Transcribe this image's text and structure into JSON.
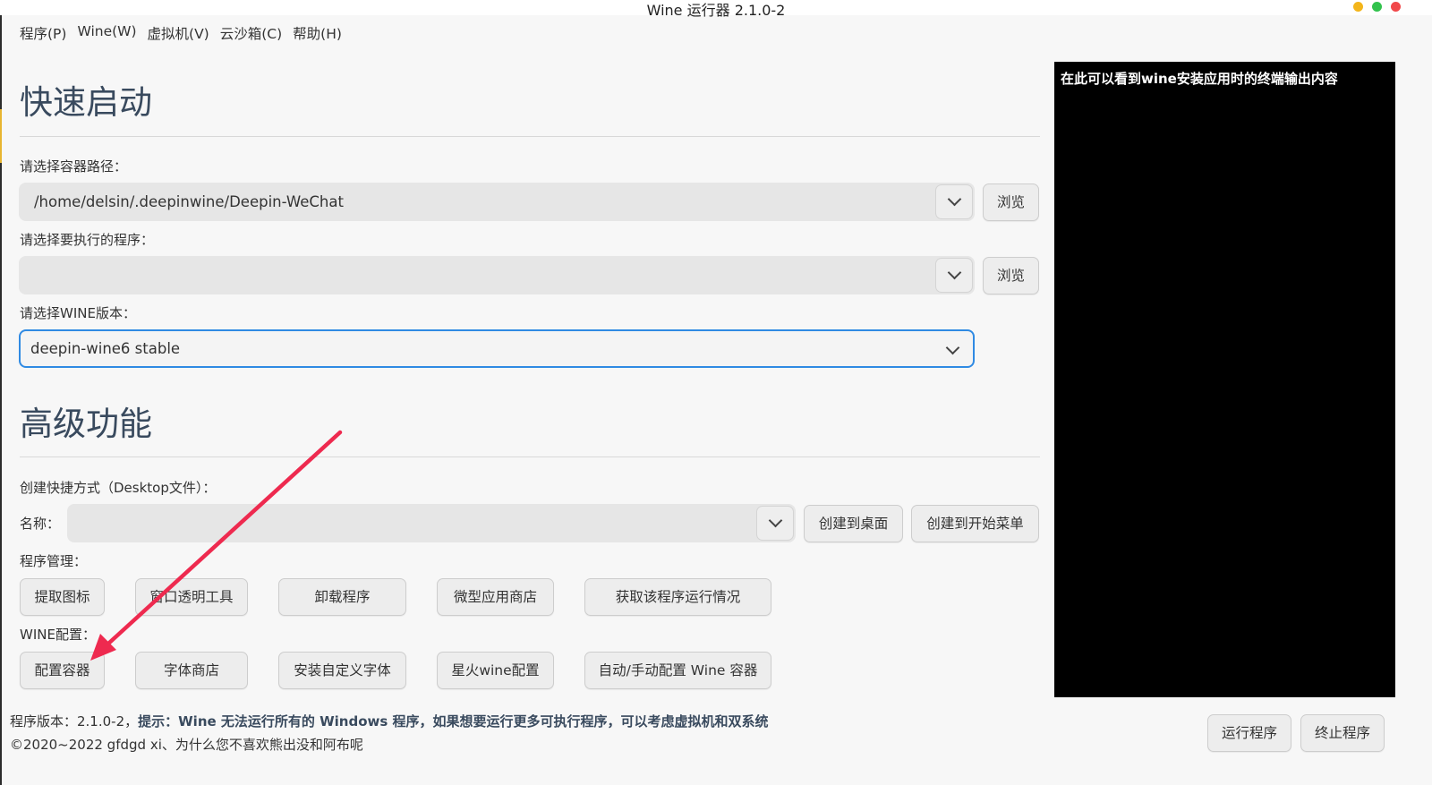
{
  "window": {
    "title": "Wine 运行器 2.1.0-2"
  },
  "menu": [
    "程序(P)",
    "Wine(W)",
    "虚拟机(V)",
    "云沙箱(C)",
    "帮助(H)"
  ],
  "quick_start": {
    "title": "快速启动",
    "container_label": "请选择容器路径：",
    "container_value": "/home/delsin/.deepinwine/Deepin-WeChat",
    "browse": "浏览",
    "program_label": "请选择要执行的程序：",
    "program_value": "",
    "wine_label": "请选择WINE版本：",
    "wine_value": "deepin-wine6 stable"
  },
  "advanced": {
    "title": "高级功能",
    "shortcut_label": "创建快捷方式（Desktop文件）：",
    "name_label": "名称：",
    "name_value": "",
    "create_desktop": "创建到桌面",
    "create_menu": "创建到开始菜单",
    "program_mgmt_label": "程序管理：",
    "program_buttons": [
      "提取图标",
      "窗口透明工具",
      "卸载程序",
      "微型应用商店",
      "获取该程序运行情况"
    ],
    "wine_config_label": "WINE配置：",
    "wine_buttons": [
      "配置容器",
      "字体商店",
      "安装自定义字体",
      "星火wine配置",
      "自动/手动配置 Wine 容器"
    ]
  },
  "terminal": {
    "text": "在此可以看到wine安装应用时的终端输出内容"
  },
  "footer": {
    "version_prefix": "程序版本：2.1.0-2，",
    "tip_label": "提示：",
    "tip_text": "Wine 无法运行所有的 Windows 程序，如果想要运行更多可执行程序，可以考虑虚拟机和双系统",
    "copyright": "©2020~2022 gfdgd xi、为什么您不喜欢熊出没和阿布呢"
  },
  "actions": {
    "run": "运行程序",
    "stop": "终止程序"
  },
  "colors": {
    "accent": "#2f8ae3",
    "annotation_arrow": "#ee2a4f",
    "heading": "#394a5e"
  }
}
